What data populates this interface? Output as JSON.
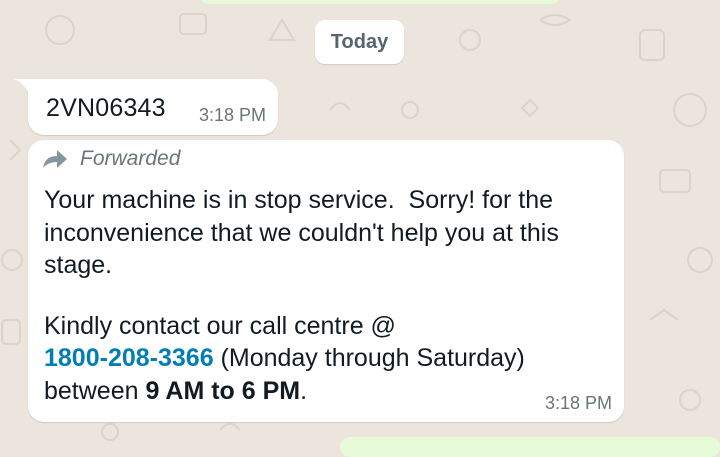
{
  "date_divider": "Today",
  "messages": [
    {
      "text": "2VN06343",
      "time": "3:18 PM"
    },
    {
      "forwarded_label": "Forwarded",
      "forward_icon": "forward-arrow-icon",
      "lines": [
        "Your machine is in stop service.  Sorry! for the",
        "inconvenience that we couldn't help you at this",
        "stage."
      ],
      "contact_prefix": "Kindly contact our call centre @",
      "phone": "1800-208-3366",
      "phone_suffix": " (Monday through Saturday)",
      "hours_prefix": "between ",
      "hours": "9 AM to 6 PM",
      "hours_suffix": ".",
      "time": "3:18 PM"
    }
  ],
  "colors": {
    "background": "#ece5dd",
    "bubble": "#ffffff",
    "link": "#027eb5",
    "outgoing_bubble": "#e7fbd8"
  }
}
